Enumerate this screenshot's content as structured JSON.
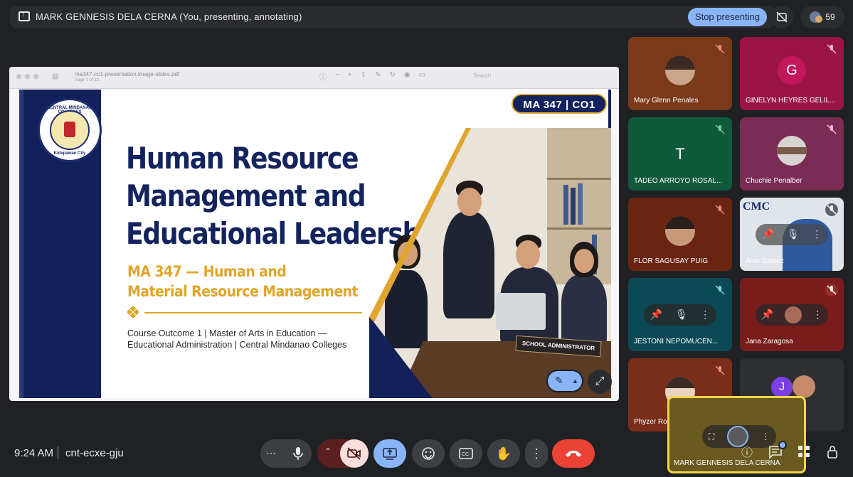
{
  "top_bar": {
    "presenting_text": "MARK GENNESIS DELA CERNA (You, presenting, annotating)",
    "stop_button": "Stop presenting",
    "participant_count": "59"
  },
  "viewer": {
    "file_name": "ma347-co1-presentation.image-slides.pdf",
    "page_info": "Page 1 of 22",
    "search_placeholder": "Search"
  },
  "slide": {
    "seal_top": "CENTRAL MINDANAO COLLEGES",
    "seal_bottom": "Kidapawan City",
    "badge": "MA 347 | CO1",
    "title_lines": [
      "Human Resource",
      "Management and",
      "Educational Leadership"
    ],
    "subtitle_lines": [
      "MA 347 — Human and",
      "Material Resource Management"
    ],
    "outcome_lines": [
      "Course Outcome 1 | Master of Arts in Education —",
      "Educational Administration | Central Mindanao Colleges"
    ],
    "nameplate": "SCHOOL ADMINISTRATOR"
  },
  "participants": [
    {
      "name": "Mary Glenn Penales",
      "bg": "#7a3a1a"
    },
    {
      "name": "GINELYN HEYRES GELIL...",
      "initial": "G",
      "bg": "#9a1446"
    },
    {
      "name": "TADEO ARROYO ROSAL...",
      "initial": "T",
      "bg": "#0f5a3a"
    },
    {
      "name": "Chuchie Penalber",
      "bg": "#7a2c55"
    },
    {
      "name": "FLOR SAGUSAY PUIG",
      "bg": "#6a2412"
    },
    {
      "name": "Alan Galvez",
      "bg": "#dfe5ea",
      "logo": "CMC"
    },
    {
      "name": "JESTONI NEPOMUCEN...",
      "bg": "#0b4a55"
    },
    {
      "name": "Jana Zaragosa",
      "bg": "#7a1c1c"
    },
    {
      "name": "Phyzer Ro",
      "bg": "#7a2e1a"
    },
    {
      "name": "",
      "initial": "J",
      "bg": "#2e2f33"
    }
  ],
  "self": {
    "name": "MARK GENNESIS DELA CERNA"
  },
  "bottom": {
    "time": "9:24 AM",
    "meeting_code": "cnt-ecxe-gju"
  },
  "colors": {
    "accent": "#8ab4f8",
    "end_call": "#ea4335",
    "navy": "#13235e",
    "gold": "#e0a52a"
  }
}
